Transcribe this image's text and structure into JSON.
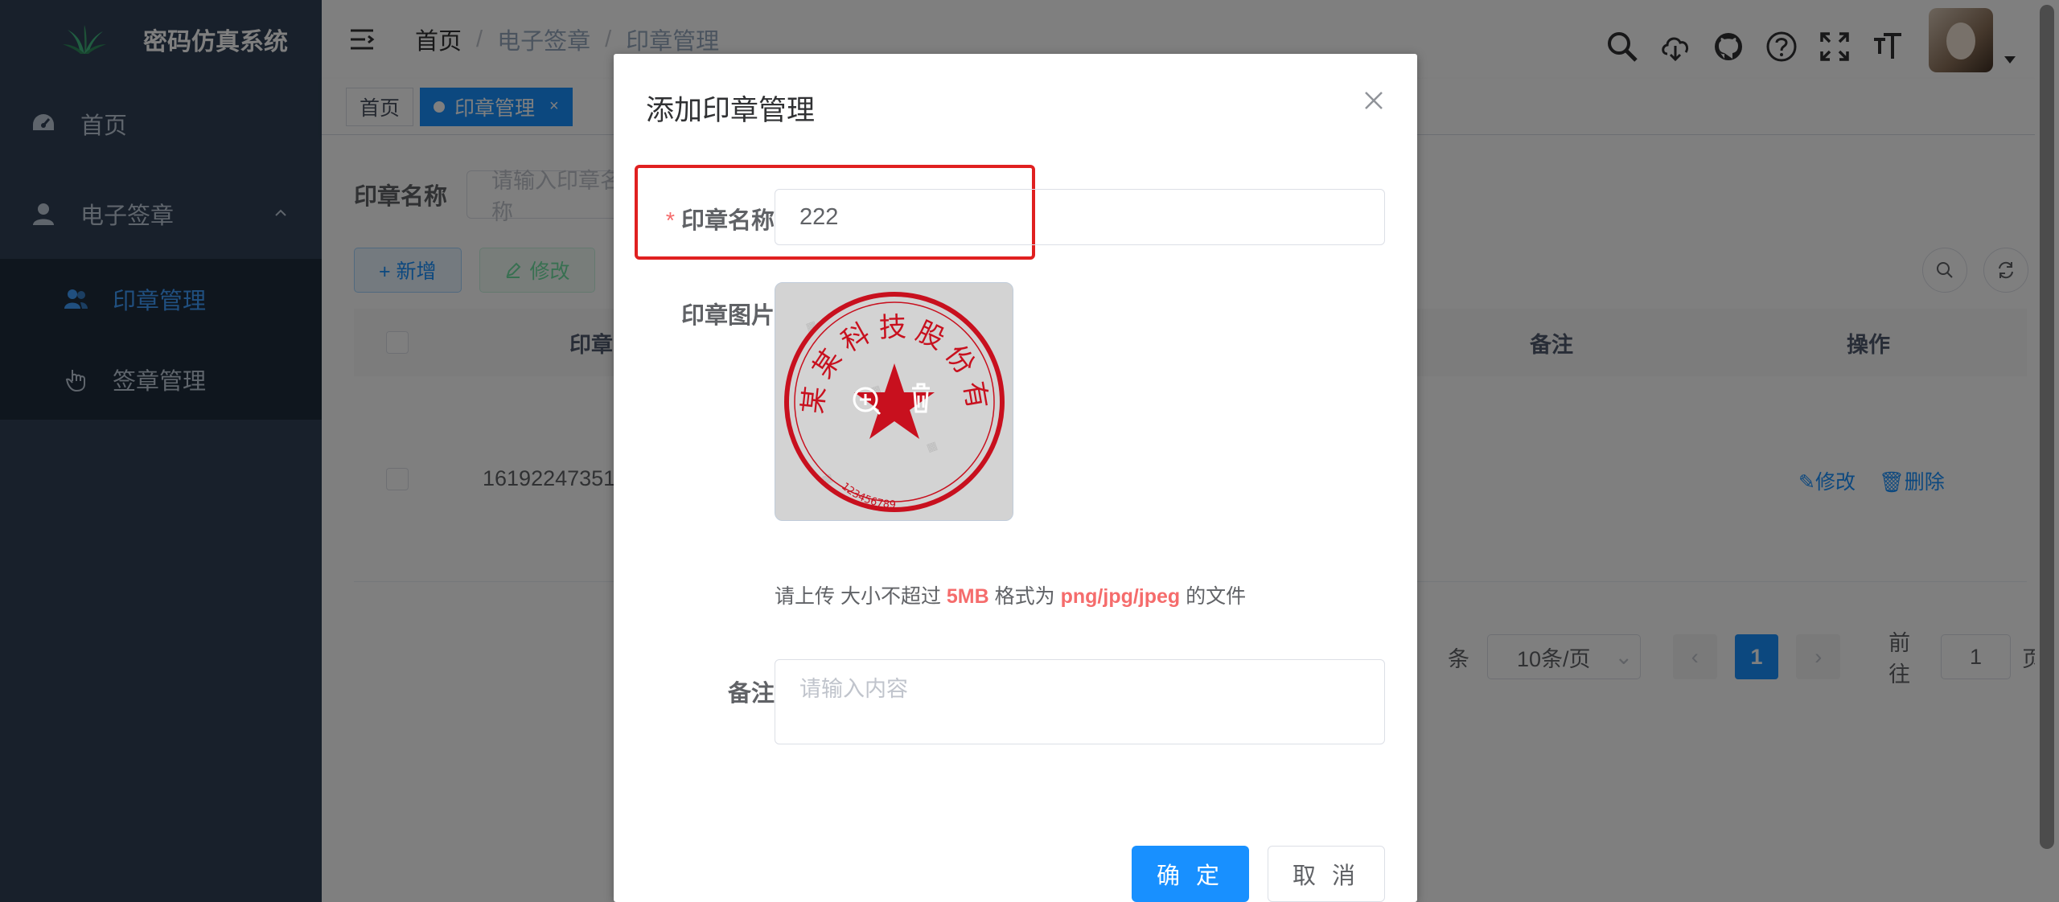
{
  "app": {
    "title": "密码仿真系统"
  },
  "sidebar": {
    "items": [
      {
        "label": "首页",
        "icon": "dashboard-icon"
      },
      {
        "label": "电子签章",
        "icon": "user-icon"
      }
    ],
    "submenu": [
      {
        "label": "印章管理",
        "icon": "peoples-icon",
        "active": true
      },
      {
        "label": "签章管理",
        "icon": "hand-icon"
      }
    ]
  },
  "breadcrumb": [
    "首页",
    "电子签章",
    "印章管理"
  ],
  "tags": [
    {
      "label": "首页"
    },
    {
      "label": "印章管理",
      "active": true
    }
  ],
  "search": {
    "label": "印章名称",
    "placeholder": "请输入印章名称"
  },
  "toolbar": {
    "add_label": "+ 新增",
    "edit_label": "修改"
  },
  "table": {
    "headers": [
      "印章",
      "备注",
      "操作"
    ],
    "rows": [
      {
        "id": "16192247351",
        "edit": "修改",
        "delete": "删除"
      }
    ]
  },
  "pagination": {
    "total_suffix": "条",
    "page_size": "10条/页",
    "current_page": "1",
    "goto_prefix": "前往",
    "goto_value": "1",
    "goto_suffix": "页"
  },
  "dialog": {
    "title": "添加印章管理",
    "name_label": "印章名称",
    "name_value": "222",
    "image_label": "印章图片",
    "tip_prefix": "请上传 大小不超过 ",
    "tip_size": "5MB",
    "tip_mid": " 格式为 ",
    "tip_formats": "png/jpg/jpeg",
    "tip_suffix": " 的文件",
    "remark_label": "备注",
    "remark_placeholder": "请输入内容",
    "ok_label": "确 定",
    "cancel_label": "取 消",
    "seal_text": "某某科技股份有限公司",
    "seal_number": "123456789"
  },
  "colors": {
    "primary": "#1890ff",
    "sidebar": "#304156",
    "danger": "#f56c6c",
    "seal": "#c8101e"
  }
}
